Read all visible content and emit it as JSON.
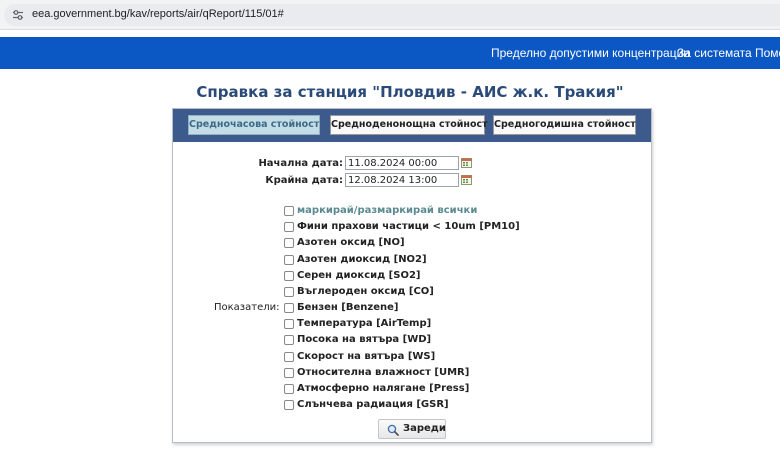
{
  "browser": {
    "url": "eea.government.bg/kav/reports/air/qReport/115/01#"
  },
  "nav": {
    "items": [
      {
        "label": "Пределно допустими концентрации"
      },
      {
        "label": "За системата"
      },
      {
        "label": "Помо"
      }
    ]
  },
  "page": {
    "title": "Справка за станция \"Пловдив - АИС ж.к. Тракия\""
  },
  "tabs": [
    {
      "label": "Средночасова стойност",
      "active": true
    },
    {
      "label": "Средноденонощна стойност",
      "active": false
    },
    {
      "label": "Средногодишна стойност",
      "active": false
    }
  ],
  "form": {
    "start_label": "Начална дата:",
    "start_value": "11.08.2024 00:00",
    "end_label": "Крайна дата:",
    "end_value": "12.08.2024 13:00",
    "indicators_label": "Показатели:",
    "toggle_all": "маркирай/размаркирай всички",
    "indicators": [
      "Фини прахови частици < 10um [PM10]",
      "Азотен оксид [NO]",
      "Азотен диоксид [NO2]",
      "Серен диоксид [SO2]",
      "Въглероден оксид [CO]",
      "Бензен [Benzene]",
      "Температура [AirTemp]",
      "Посока на вятъра [WD]",
      "Скорост на вятъра [WS]",
      "Относителна влажност [UMR]",
      "Атмосферно налягане [Press]",
      "Слънчева радиация [GSR]"
    ],
    "load_button": "Зареди"
  },
  "colors": {
    "nav_bg": "#0b57c4",
    "tabbar_bg": "#3d5a8c",
    "title": "#2a4a78",
    "active_tab_bg": "#c4dce6"
  },
  "icons": {
    "site_info": "tune-icon",
    "calendar": "calendar-icon",
    "search": "search-icon"
  }
}
